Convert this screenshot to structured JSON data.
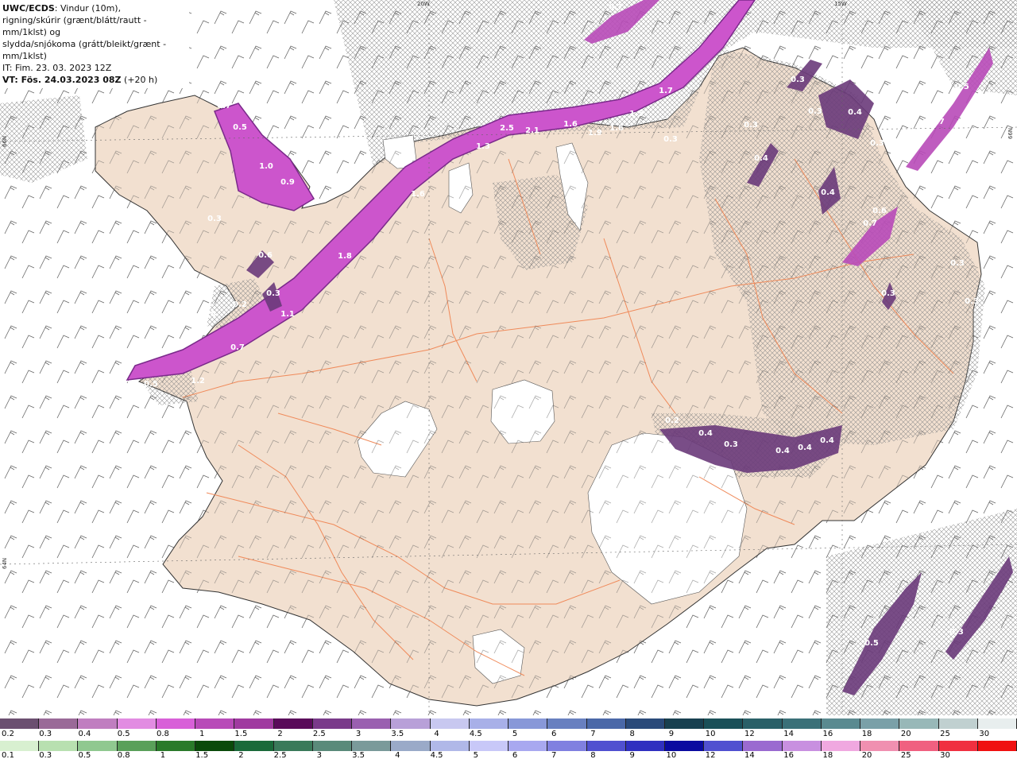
{
  "header": {
    "title": "UWC/ECDS",
    "line1_rest": ": Vindur (10m),",
    "line2": "rigning/skúrir (grænt/blátt/rautt - mm/1klst) og",
    "line3": "slydda/snjókoma (grátt/bleikt/grænt - mm/1klst)",
    "issue_time": "IT: Fim. 23. 03. 2023 12Z",
    "valid_prefix": "VT: Fös. 24.03.2023 08Z",
    "valid_suffix": " (+20 h)"
  },
  "grid_labels": {
    "lon_20w": "20W",
    "lon_15w": "15W",
    "lat_66n": "66N",
    "lat_66n_right": "66N",
    "lat_64n": "64N"
  },
  "colors": {
    "land": "#f2e0d0",
    "road": "#f08a5a",
    "glacier": "#ffffff",
    "sea": "#ffffff",
    "snow_heavy": "#cc55cc",
    "snow_light": "#ee99ee",
    "snow_dark": "#6a3a7a",
    "barb": "#444444"
  },
  "map_values": [
    "0.7",
    "0.5",
    "1.0",
    "0.9",
    "0.3",
    "0.6",
    "0.3",
    "0.2",
    "0.6",
    "1.1",
    "0.7",
    "0.3",
    "0.5",
    "1.2",
    "1.8",
    "1.6",
    "1.3",
    "2.5",
    "2.1",
    "1.6",
    "1.9",
    "1.6",
    "1.5",
    "1.7",
    "0.3",
    "0.7",
    "0.3",
    "0.3",
    "0.4",
    "0.3",
    "0.4",
    "0.4",
    "0.3",
    "0.5",
    "0.7",
    "0.3",
    "0.6",
    "0.7",
    "0.3",
    "0.3",
    "0.2",
    "0.4",
    "0.3",
    "0.4",
    "0.4",
    "0.4",
    "0.5",
    "0.3"
  ],
  "legend": {
    "snow_labels": [
      "0.2",
      "0.3",
      "0.4",
      "0.5",
      "0.8",
      "1",
      "1.5",
      "2",
      "2.5",
      "3",
      "3.5",
      "4",
      "4.5",
      "5",
      "6",
      "7",
      "8",
      "9",
      "10",
      "12",
      "14",
      "16",
      "18",
      "20",
      "25",
      "30"
    ],
    "snow_colors": [
      "#6b4f70",
      "#9a6a98",
      "#c07ec0",
      "#e28ce2",
      "#d860d8",
      "#b84ab8",
      "#a03aa0",
      "#5a0a5a",
      "#7a3a8a",
      "#9a60b0",
      "#b8a0d8",
      "#c8c8f0",
      "#a8b0e8",
      "#8898d8",
      "#6880c0",
      "#4a68a8",
      "#2a4a7a",
      "#184050",
      "#1a5058",
      "#2a6068",
      "#3a7078",
      "#5a8a90",
      "#7aa0a8",
      "#98b8b8",
      "#c0d0d0",
      "#e8eeee"
    ],
    "rain_labels": [
      "0.1",
      "0.3",
      "0.5",
      "0.8",
      "1",
      "1.5",
      "2",
      "2.5",
      "3",
      "3.5",
      "4",
      "4.5",
      "5",
      "6",
      "7",
      "8",
      "9",
      "10",
      "12",
      "14",
      "16",
      "18",
      "20",
      "25",
      "30"
    ],
    "rain_colors": [
      "#d8f0d0",
      "#b8e0b0",
      "#90c890",
      "#5aa05a",
      "#2a7a2a",
      "#0a4a0a",
      "#1a6a3a",
      "#3a7a5a",
      "#5a8a7a",
      "#7a9a9a",
      "#9aaac8",
      "#b0b8e8",
      "#c8c8f8",
      "#a8a8f0",
      "#8080e0",
      "#5050d0",
      "#3030c0",
      "#0a0aa0",
      "#5050d0",
      "#9a6ad0",
      "#c890e0",
      "#f0a8e0",
      "#f090b0",
      "#f06080",
      "#f03040",
      "#f01010"
    ]
  }
}
